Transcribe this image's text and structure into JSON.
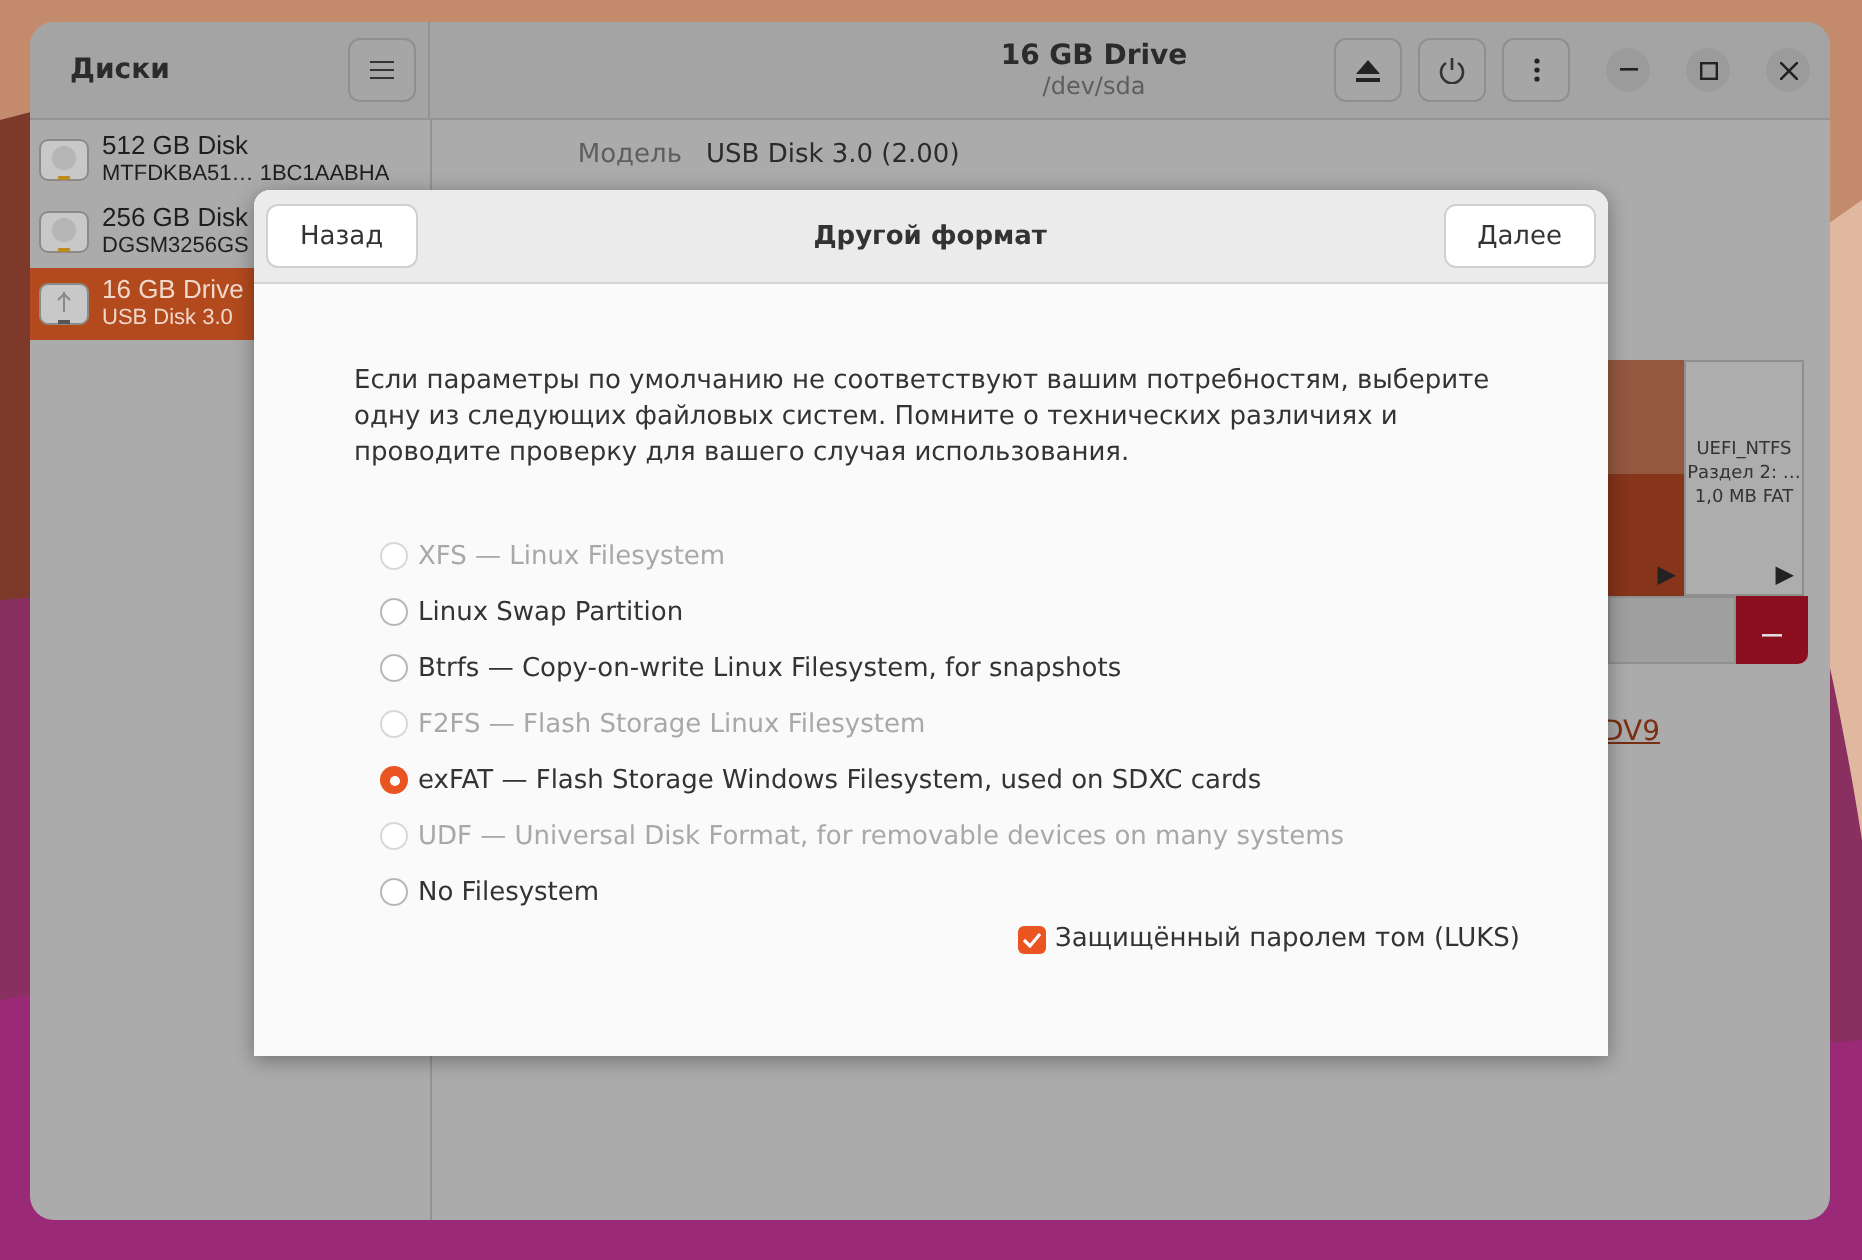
{
  "window": {
    "sidebar_title": "Диски",
    "title": "16 GB Drive",
    "subtitle": "/dev/sda"
  },
  "drives": [
    {
      "name": "512 GB Disk",
      "detail": "MTFDKBA51… 1BC1AABHA",
      "kind": "disk",
      "selected": false
    },
    {
      "name": "256 GB Disk",
      "detail": "DGSM3256GS",
      "kind": "disk",
      "selected": false
    },
    {
      "name": "16 GB Drive",
      "detail": "USB Disk 3.0",
      "kind": "usb",
      "selected": true
    }
  ],
  "details": [
    {
      "label": "Модель",
      "value": "USB Disk 3.0 (2.00)"
    }
  ],
  "volume": {
    "play": "▶"
  },
  "partition": {
    "name": "UEFI_NTFS",
    "detail": "Раздел 2: …",
    "size": "1,0 MB FAT",
    "play": "▶"
  },
  "link": "DV9",
  "dialog": {
    "back": "Назад",
    "title": "Другой формат",
    "next": "Далее",
    "intro": "Если параметры по умолчанию не соответствуют вашим потребностям, выберите одну из следующих файловых систем. Помните о технических различиях и проводите проверку для вашего случая использования.",
    "options": [
      {
        "label": "XFS — Linux Filesystem",
        "selected": false,
        "disabled": true
      },
      {
        "label": "Linux Swap Partition",
        "selected": false,
        "disabled": false
      },
      {
        "label": "Btrfs — Copy-on-write Linux Filesystem, for snapshots",
        "selected": false,
        "disabled": false
      },
      {
        "label": "F2FS — Flash Storage Linux Filesystem",
        "selected": false,
        "disabled": true
      },
      {
        "label": "exFAT — Flash Storage Windows Filesystem, used on SDXC cards",
        "selected": true,
        "disabled": false
      },
      {
        "label": "UDF — Universal Disk Format, for removable devices on many systems",
        "selected": false,
        "disabled": true
      },
      {
        "label": "No Filesystem",
        "selected": false,
        "disabled": false
      }
    ],
    "luks": {
      "label": "Защищённый паролем том (LUKS)",
      "checked": true
    }
  }
}
